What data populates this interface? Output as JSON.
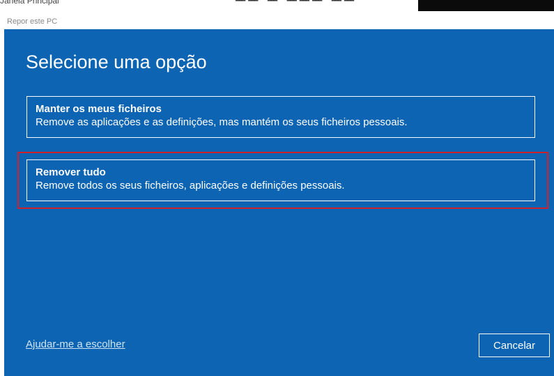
{
  "background_window": {
    "cropped_text": "Janela Principal"
  },
  "window": {
    "title": "Repor este PC"
  },
  "dialog": {
    "heading": "Selecione uma opção",
    "options": [
      {
        "title": "Manter os meus ficheiros",
        "description": "Remove as aplicações e as definições, mas mantém os seus ficheiros pessoais."
      },
      {
        "title": "Remover tudo",
        "description": "Remove todos os seus ficheiros, aplicações e definições pessoais."
      }
    ],
    "help_link": "Ajudar-me a escolher",
    "cancel_label": "Cancelar"
  },
  "colors": {
    "panel_background": "#0c64b3",
    "highlight_border": "#d0202a",
    "text": "#ffffff"
  }
}
